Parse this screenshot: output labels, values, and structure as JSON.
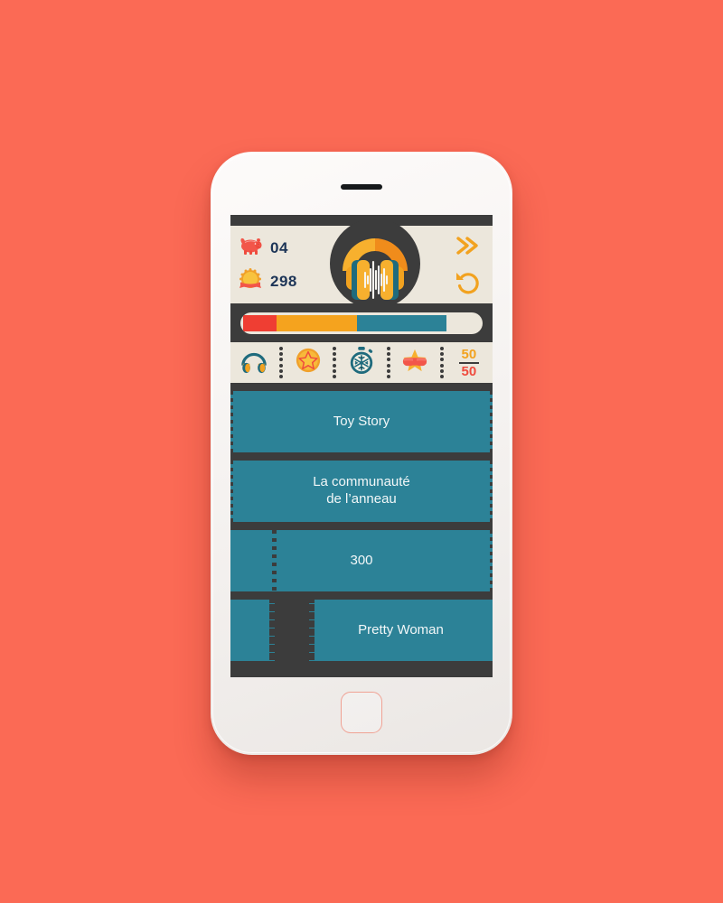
{
  "app": {
    "background_color": "#fb6a55",
    "screen_bg": "#3c3c3c",
    "panel_bg": "#ece7dc",
    "accent_orange": "#f5a31e",
    "accent_teal": "#2c8297",
    "accent_red": "#ef3e33",
    "text_navy": "#1d3557"
  },
  "header": {
    "logo_icon": "headphones-waveform-logo",
    "stats": [
      {
        "icon": "piggy-bank-icon",
        "value": "04",
        "name": "coins"
      },
      {
        "icon": "medal-badge-icon",
        "value": "298",
        "name": "score"
      }
    ],
    "actions": [
      {
        "icon": "double-chevron-right-icon",
        "name": "skip-button"
      },
      {
        "icon": "rotate-counterclockwise-icon",
        "name": "replay-button"
      }
    ]
  },
  "progress": {
    "segments": [
      {
        "name": "red",
        "color": "#ef3e33",
        "percent": 14
      },
      {
        "name": "orange",
        "color": "#f5a31e",
        "percent": 34
      },
      {
        "name": "teal",
        "color": "#2c8297",
        "percent": 38
      }
    ],
    "remaining_percent": 14,
    "track_color": "#ece7dc"
  },
  "powerups": [
    {
      "name": "powerup-listen-again",
      "icon": "headphones-icon",
      "label": ""
    },
    {
      "name": "powerup-star",
      "icon": "star-coin-icon",
      "label": ""
    },
    {
      "name": "powerup-freeze-time",
      "icon": "snowflake-stopwatch-icon",
      "label": ""
    },
    {
      "name": "powerup-star-glasses",
      "icon": "star-sunglasses-icon",
      "label": ""
    },
    {
      "name": "powerup-fifty-fifty",
      "icon": "fifty-fifty-icon",
      "label_top": "50",
      "label_bottom": "50"
    }
  ],
  "answers": [
    {
      "name": "answer-option-1",
      "text": "Toy Story",
      "lines": [
        "Toy Story"
      ]
    },
    {
      "name": "answer-option-2",
      "text": "La communauté de l’anneau",
      "lines": [
        "La communauté",
        "de l’anneau"
      ]
    },
    {
      "name": "answer-option-3",
      "text": "300",
      "lines": [
        "300"
      ]
    },
    {
      "name": "answer-option-4",
      "text": "Pretty Woman",
      "lines": [
        "Pretty Woman"
      ]
    }
  ],
  "phone": {
    "speaker": "speaker-grille",
    "home_button": "home-button"
  }
}
